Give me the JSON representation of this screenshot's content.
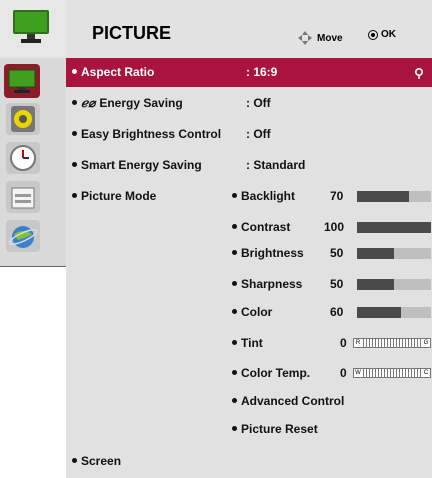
{
  "header": {
    "title": "PICTURE",
    "move_label": "Move",
    "ok_label": "OK"
  },
  "sidebar": {
    "tabs": [
      {
        "icon": "picture-tab-icon"
      },
      {
        "icon": "audio-tab-icon"
      },
      {
        "icon": "time-tab-icon"
      },
      {
        "icon": "option-tab-icon"
      },
      {
        "icon": "network-tab-icon"
      }
    ]
  },
  "menu": {
    "aspect_ratio": {
      "label": "Aspect Ratio",
      "value": ": 16:9"
    },
    "energy_saving": {
      "label": "Energy Saving",
      "value": ": Off"
    },
    "easy_brightness": {
      "label": "Easy Brightness Control",
      "value": ": Off"
    },
    "smart_energy": {
      "label": "Smart Energy Saving",
      "value": ": Standard"
    },
    "picture_mode": {
      "label": "Picture Mode"
    },
    "screen": {
      "label": "Screen"
    }
  },
  "picture_mode": {
    "backlight": {
      "label": "Backlight",
      "value": "70",
      "level": 0.7
    },
    "contrast": {
      "label": "Contrast",
      "value": "100",
      "level": 1.0
    },
    "brightness": {
      "label": "Brightness",
      "value": "50",
      "level": 0.5
    },
    "sharpness": {
      "label": "Sharpness",
      "value": "50",
      "level": 0.5
    },
    "color": {
      "label": "Color",
      "value": "60",
      "level": 0.6
    },
    "tint": {
      "label": "Tint",
      "value": "0",
      "left": "R",
      "right": "G"
    },
    "color_temp": {
      "label": "Color Temp.",
      "value": "0",
      "left": "W",
      "right": "C"
    },
    "advanced": {
      "label": "Advanced Control"
    },
    "reset": {
      "label": "Picture Reset"
    }
  },
  "colors": {
    "highlight": "#a8143d",
    "panel": "#e1e1e1",
    "sidebar_selected": "#8b1c2a"
  }
}
